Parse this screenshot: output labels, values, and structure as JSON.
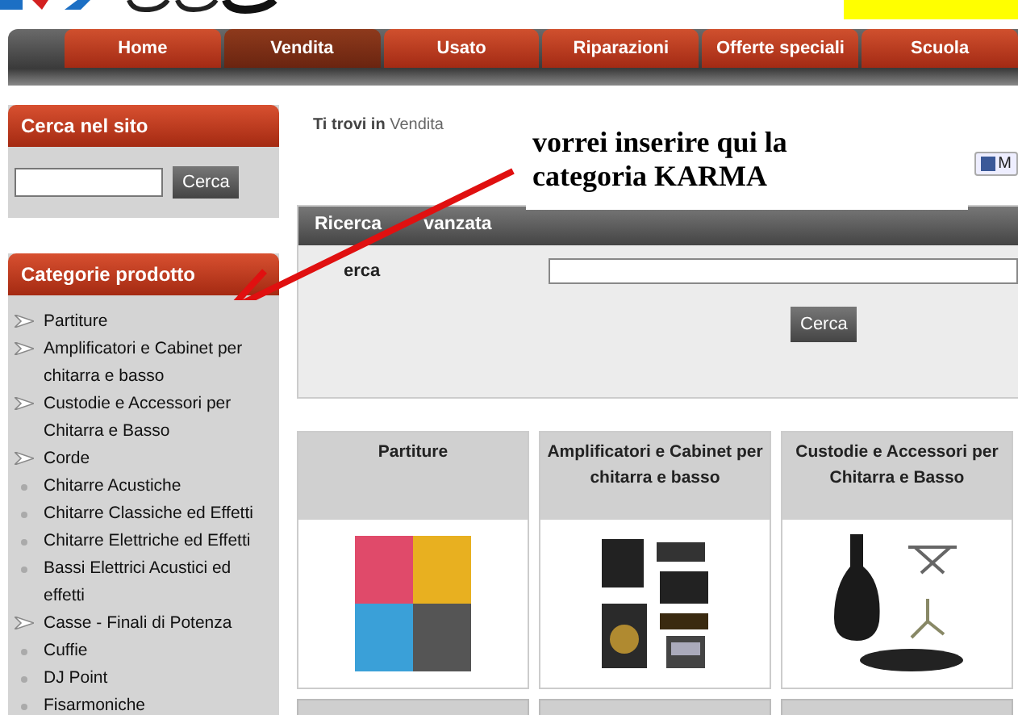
{
  "nav": {
    "tabs": [
      {
        "label": "Home",
        "selected": false
      },
      {
        "label": "Vendita",
        "selected": true
      },
      {
        "label": "Usato",
        "selected": false
      },
      {
        "label": "Riparazioni",
        "selected": false
      },
      {
        "label": "Offerte speciali",
        "selected": false
      },
      {
        "label": "Scuola",
        "selected": false
      }
    ]
  },
  "sidebar": {
    "search": {
      "title": "Cerca nel sito",
      "button": "Cerca"
    },
    "categories": {
      "title": "Categorie prodotto",
      "items": [
        {
          "label": "Partiture",
          "kind": "arrow"
        },
        {
          "label": "Amplificatori e Cabinet per chitarra e basso",
          "kind": "arrow"
        },
        {
          "label": "Custodie e Accessori per Chitarra e Basso",
          "kind": "arrow"
        },
        {
          "label": "Corde",
          "kind": "arrow"
        },
        {
          "label": "Chitarre Acustiche",
          "kind": "bullet"
        },
        {
          "label": "Chitarre Classiche ed Effetti",
          "kind": "bullet"
        },
        {
          "label": "Chitarre Elettriche ed Effetti",
          "kind": "bullet"
        },
        {
          "label": "Bassi Elettrici Acustici ed effetti",
          "kind": "bullet"
        },
        {
          "label": "Casse - Finali di Potenza",
          "kind": "arrow"
        },
        {
          "label": "Cuffie",
          "kind": "bullet"
        },
        {
          "label": "DJ Point",
          "kind": "bullet"
        },
        {
          "label": "Fisarmoniche",
          "kind": "bullet"
        }
      ]
    }
  },
  "breadcrumb": {
    "label": "Ti trovi in",
    "current": "Vendita"
  },
  "facebook_button": {
    "label": "M"
  },
  "advanced_search": {
    "title_parts": [
      "Ricerca",
      "vanzata"
    ],
    "field_label": "erca",
    "button": "Cerca"
  },
  "products": [
    {
      "title": "Partiture",
      "kind": "books"
    },
    {
      "title": "Amplificatori e Cabinet per chitarra e basso",
      "kind": "amps"
    },
    {
      "title": "Custodie e Accessori per Chitarra e Basso",
      "kind": "cases"
    }
  ],
  "annotation": {
    "text": "vorrei inserire qui la categoria KARMA"
  }
}
